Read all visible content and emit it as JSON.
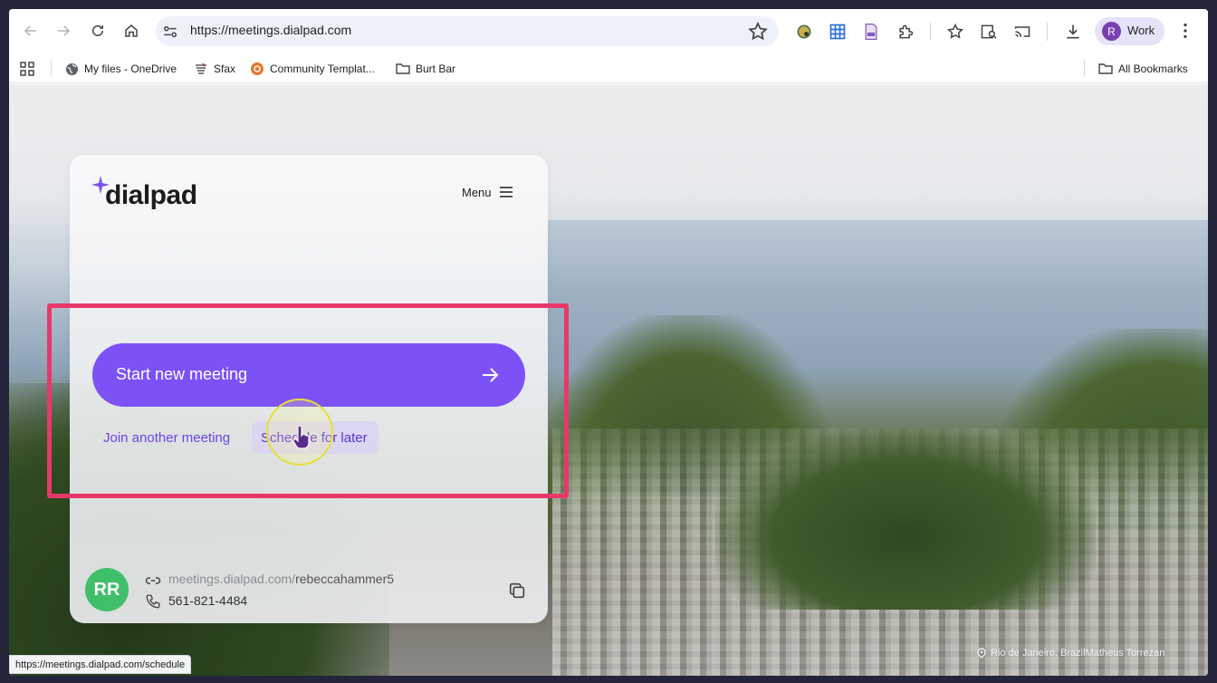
{
  "browser": {
    "url": "https://meetings.dialpad.com",
    "profile": {
      "initial": "R",
      "label": "Work"
    },
    "bookmarks": [
      {
        "label": "My files - OneDrive",
        "icon": "globe-icon"
      },
      {
        "label": "Sfax",
        "icon": "sfax-icon"
      },
      {
        "label": "Community Templat...",
        "icon": "community-icon"
      },
      {
        "label": "Burt Bar",
        "icon": "folder-icon"
      }
    ],
    "all_bookmarks": "All Bookmarks",
    "status_url": "https://meetings.dialpad.com/schedule"
  },
  "panel": {
    "logo": "dialpad",
    "menu_label": "Menu",
    "start_meeting_label": "Start new meeting",
    "join_label": "Join another meeting",
    "schedule_label": "Schedule for later",
    "user": {
      "initials": "RR",
      "url_prefix": "meetings.dialpad.com/",
      "url_handle": "rebeccahammer5",
      "phone": "561-821-4484"
    }
  },
  "background": {
    "credit": "Rio de Janeiro, BrazilMatheus Torrezan"
  },
  "colors": {
    "accent": "#7c52f7",
    "link": "#6b43e8",
    "highlight_border": "#e8386a",
    "avatar": "#3fbf6a"
  }
}
